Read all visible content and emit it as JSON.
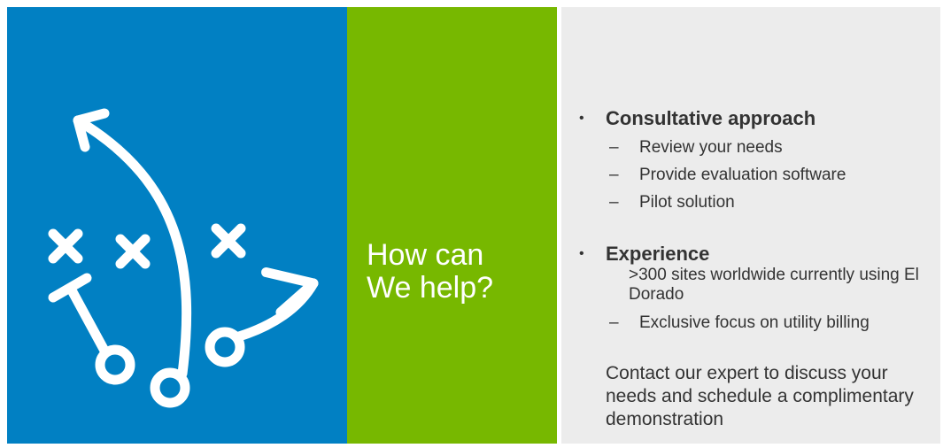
{
  "left_panel": {
    "color": "#0180c3",
    "icon": "football-play-diagram-icon"
  },
  "middle_panel": {
    "color": "#77b800",
    "question_line1": "How can",
    "question_line2": "We help?"
  },
  "right_panel": {
    "color": "#ececec",
    "sections": [
      {
        "bullet": "•",
        "title": "Consultative approach",
        "items": [
          {
            "dash": "–",
            "text": "Review your needs"
          },
          {
            "dash": "–",
            "text": "Provide evaluation  software"
          },
          {
            "dash": "–",
            "text": "Pilot solution"
          }
        ]
      },
      {
        "bullet": "•",
        "title": "Experience",
        "plain_item": ">300 sites worldwide currently  using El Dorado",
        "items": [
          {
            "dash": "–",
            "text": "Exclusive  focus on utility billing"
          }
        ]
      }
    ],
    "contact": "Contact our expert to discuss your needs and schedule a complimentary  demonstration"
  }
}
